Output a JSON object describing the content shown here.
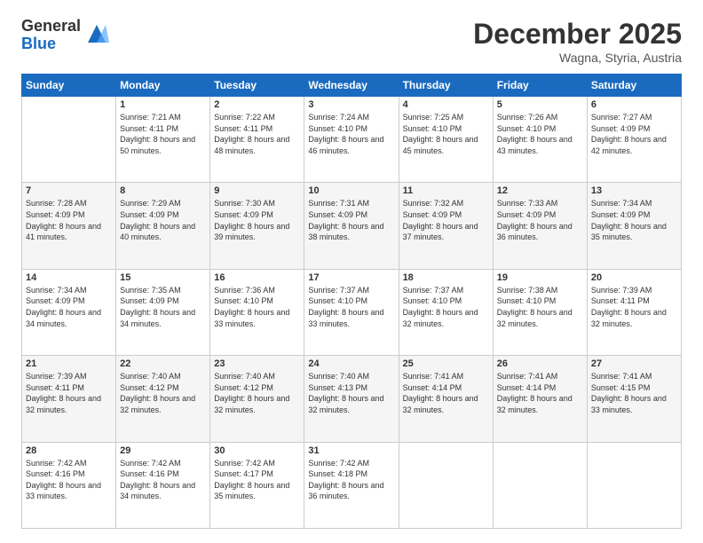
{
  "header": {
    "logo_general": "General",
    "logo_blue": "Blue",
    "month_title": "December 2025",
    "location": "Wagna, Styria, Austria"
  },
  "weekdays": [
    "Sunday",
    "Monday",
    "Tuesday",
    "Wednesday",
    "Thursday",
    "Friday",
    "Saturday"
  ],
  "weeks": [
    [
      {
        "day": "",
        "sunrise": "",
        "sunset": "",
        "daylight": ""
      },
      {
        "day": "1",
        "sunrise": "Sunrise: 7:21 AM",
        "sunset": "Sunset: 4:11 PM",
        "daylight": "Daylight: 8 hours and 50 minutes."
      },
      {
        "day": "2",
        "sunrise": "Sunrise: 7:22 AM",
        "sunset": "Sunset: 4:11 PM",
        "daylight": "Daylight: 8 hours and 48 minutes."
      },
      {
        "day": "3",
        "sunrise": "Sunrise: 7:24 AM",
        "sunset": "Sunset: 4:10 PM",
        "daylight": "Daylight: 8 hours and 46 minutes."
      },
      {
        "day": "4",
        "sunrise": "Sunrise: 7:25 AM",
        "sunset": "Sunset: 4:10 PM",
        "daylight": "Daylight: 8 hours and 45 minutes."
      },
      {
        "day": "5",
        "sunrise": "Sunrise: 7:26 AM",
        "sunset": "Sunset: 4:10 PM",
        "daylight": "Daylight: 8 hours and 43 minutes."
      },
      {
        "day": "6",
        "sunrise": "Sunrise: 7:27 AM",
        "sunset": "Sunset: 4:09 PM",
        "daylight": "Daylight: 8 hours and 42 minutes."
      }
    ],
    [
      {
        "day": "7",
        "sunrise": "Sunrise: 7:28 AM",
        "sunset": "Sunset: 4:09 PM",
        "daylight": "Daylight: 8 hours and 41 minutes."
      },
      {
        "day": "8",
        "sunrise": "Sunrise: 7:29 AM",
        "sunset": "Sunset: 4:09 PM",
        "daylight": "Daylight: 8 hours and 40 minutes."
      },
      {
        "day": "9",
        "sunrise": "Sunrise: 7:30 AM",
        "sunset": "Sunset: 4:09 PM",
        "daylight": "Daylight: 8 hours and 39 minutes."
      },
      {
        "day": "10",
        "sunrise": "Sunrise: 7:31 AM",
        "sunset": "Sunset: 4:09 PM",
        "daylight": "Daylight: 8 hours and 38 minutes."
      },
      {
        "day": "11",
        "sunrise": "Sunrise: 7:32 AM",
        "sunset": "Sunset: 4:09 PM",
        "daylight": "Daylight: 8 hours and 37 minutes."
      },
      {
        "day": "12",
        "sunrise": "Sunrise: 7:33 AM",
        "sunset": "Sunset: 4:09 PM",
        "daylight": "Daylight: 8 hours and 36 minutes."
      },
      {
        "day": "13",
        "sunrise": "Sunrise: 7:34 AM",
        "sunset": "Sunset: 4:09 PM",
        "daylight": "Daylight: 8 hours and 35 minutes."
      }
    ],
    [
      {
        "day": "14",
        "sunrise": "Sunrise: 7:34 AM",
        "sunset": "Sunset: 4:09 PM",
        "daylight": "Daylight: 8 hours and 34 minutes."
      },
      {
        "day": "15",
        "sunrise": "Sunrise: 7:35 AM",
        "sunset": "Sunset: 4:09 PM",
        "daylight": "Daylight: 8 hours and 34 minutes."
      },
      {
        "day": "16",
        "sunrise": "Sunrise: 7:36 AM",
        "sunset": "Sunset: 4:10 PM",
        "daylight": "Daylight: 8 hours and 33 minutes."
      },
      {
        "day": "17",
        "sunrise": "Sunrise: 7:37 AM",
        "sunset": "Sunset: 4:10 PM",
        "daylight": "Daylight: 8 hours and 33 minutes."
      },
      {
        "day": "18",
        "sunrise": "Sunrise: 7:37 AM",
        "sunset": "Sunset: 4:10 PM",
        "daylight": "Daylight: 8 hours and 32 minutes."
      },
      {
        "day": "19",
        "sunrise": "Sunrise: 7:38 AM",
        "sunset": "Sunset: 4:10 PM",
        "daylight": "Daylight: 8 hours and 32 minutes."
      },
      {
        "day": "20",
        "sunrise": "Sunrise: 7:39 AM",
        "sunset": "Sunset: 4:11 PM",
        "daylight": "Daylight: 8 hours and 32 minutes."
      }
    ],
    [
      {
        "day": "21",
        "sunrise": "Sunrise: 7:39 AM",
        "sunset": "Sunset: 4:11 PM",
        "daylight": "Daylight: 8 hours and 32 minutes."
      },
      {
        "day": "22",
        "sunrise": "Sunrise: 7:40 AM",
        "sunset": "Sunset: 4:12 PM",
        "daylight": "Daylight: 8 hours and 32 minutes."
      },
      {
        "day": "23",
        "sunrise": "Sunrise: 7:40 AM",
        "sunset": "Sunset: 4:12 PM",
        "daylight": "Daylight: 8 hours and 32 minutes."
      },
      {
        "day": "24",
        "sunrise": "Sunrise: 7:40 AM",
        "sunset": "Sunset: 4:13 PM",
        "daylight": "Daylight: 8 hours and 32 minutes."
      },
      {
        "day": "25",
        "sunrise": "Sunrise: 7:41 AM",
        "sunset": "Sunset: 4:14 PM",
        "daylight": "Daylight: 8 hours and 32 minutes."
      },
      {
        "day": "26",
        "sunrise": "Sunrise: 7:41 AM",
        "sunset": "Sunset: 4:14 PM",
        "daylight": "Daylight: 8 hours and 32 minutes."
      },
      {
        "day": "27",
        "sunrise": "Sunrise: 7:41 AM",
        "sunset": "Sunset: 4:15 PM",
        "daylight": "Daylight: 8 hours and 33 minutes."
      }
    ],
    [
      {
        "day": "28",
        "sunrise": "Sunrise: 7:42 AM",
        "sunset": "Sunset: 4:16 PM",
        "daylight": "Daylight: 8 hours and 33 minutes."
      },
      {
        "day": "29",
        "sunrise": "Sunrise: 7:42 AM",
        "sunset": "Sunset: 4:16 PM",
        "daylight": "Daylight: 8 hours and 34 minutes."
      },
      {
        "day": "30",
        "sunrise": "Sunrise: 7:42 AM",
        "sunset": "Sunset: 4:17 PM",
        "daylight": "Daylight: 8 hours and 35 minutes."
      },
      {
        "day": "31",
        "sunrise": "Sunrise: 7:42 AM",
        "sunset": "Sunset: 4:18 PM",
        "daylight": "Daylight: 8 hours and 36 minutes."
      },
      {
        "day": "",
        "sunrise": "",
        "sunset": "",
        "daylight": ""
      },
      {
        "day": "",
        "sunrise": "",
        "sunset": "",
        "daylight": ""
      },
      {
        "day": "",
        "sunrise": "",
        "sunset": "",
        "daylight": ""
      }
    ]
  ]
}
